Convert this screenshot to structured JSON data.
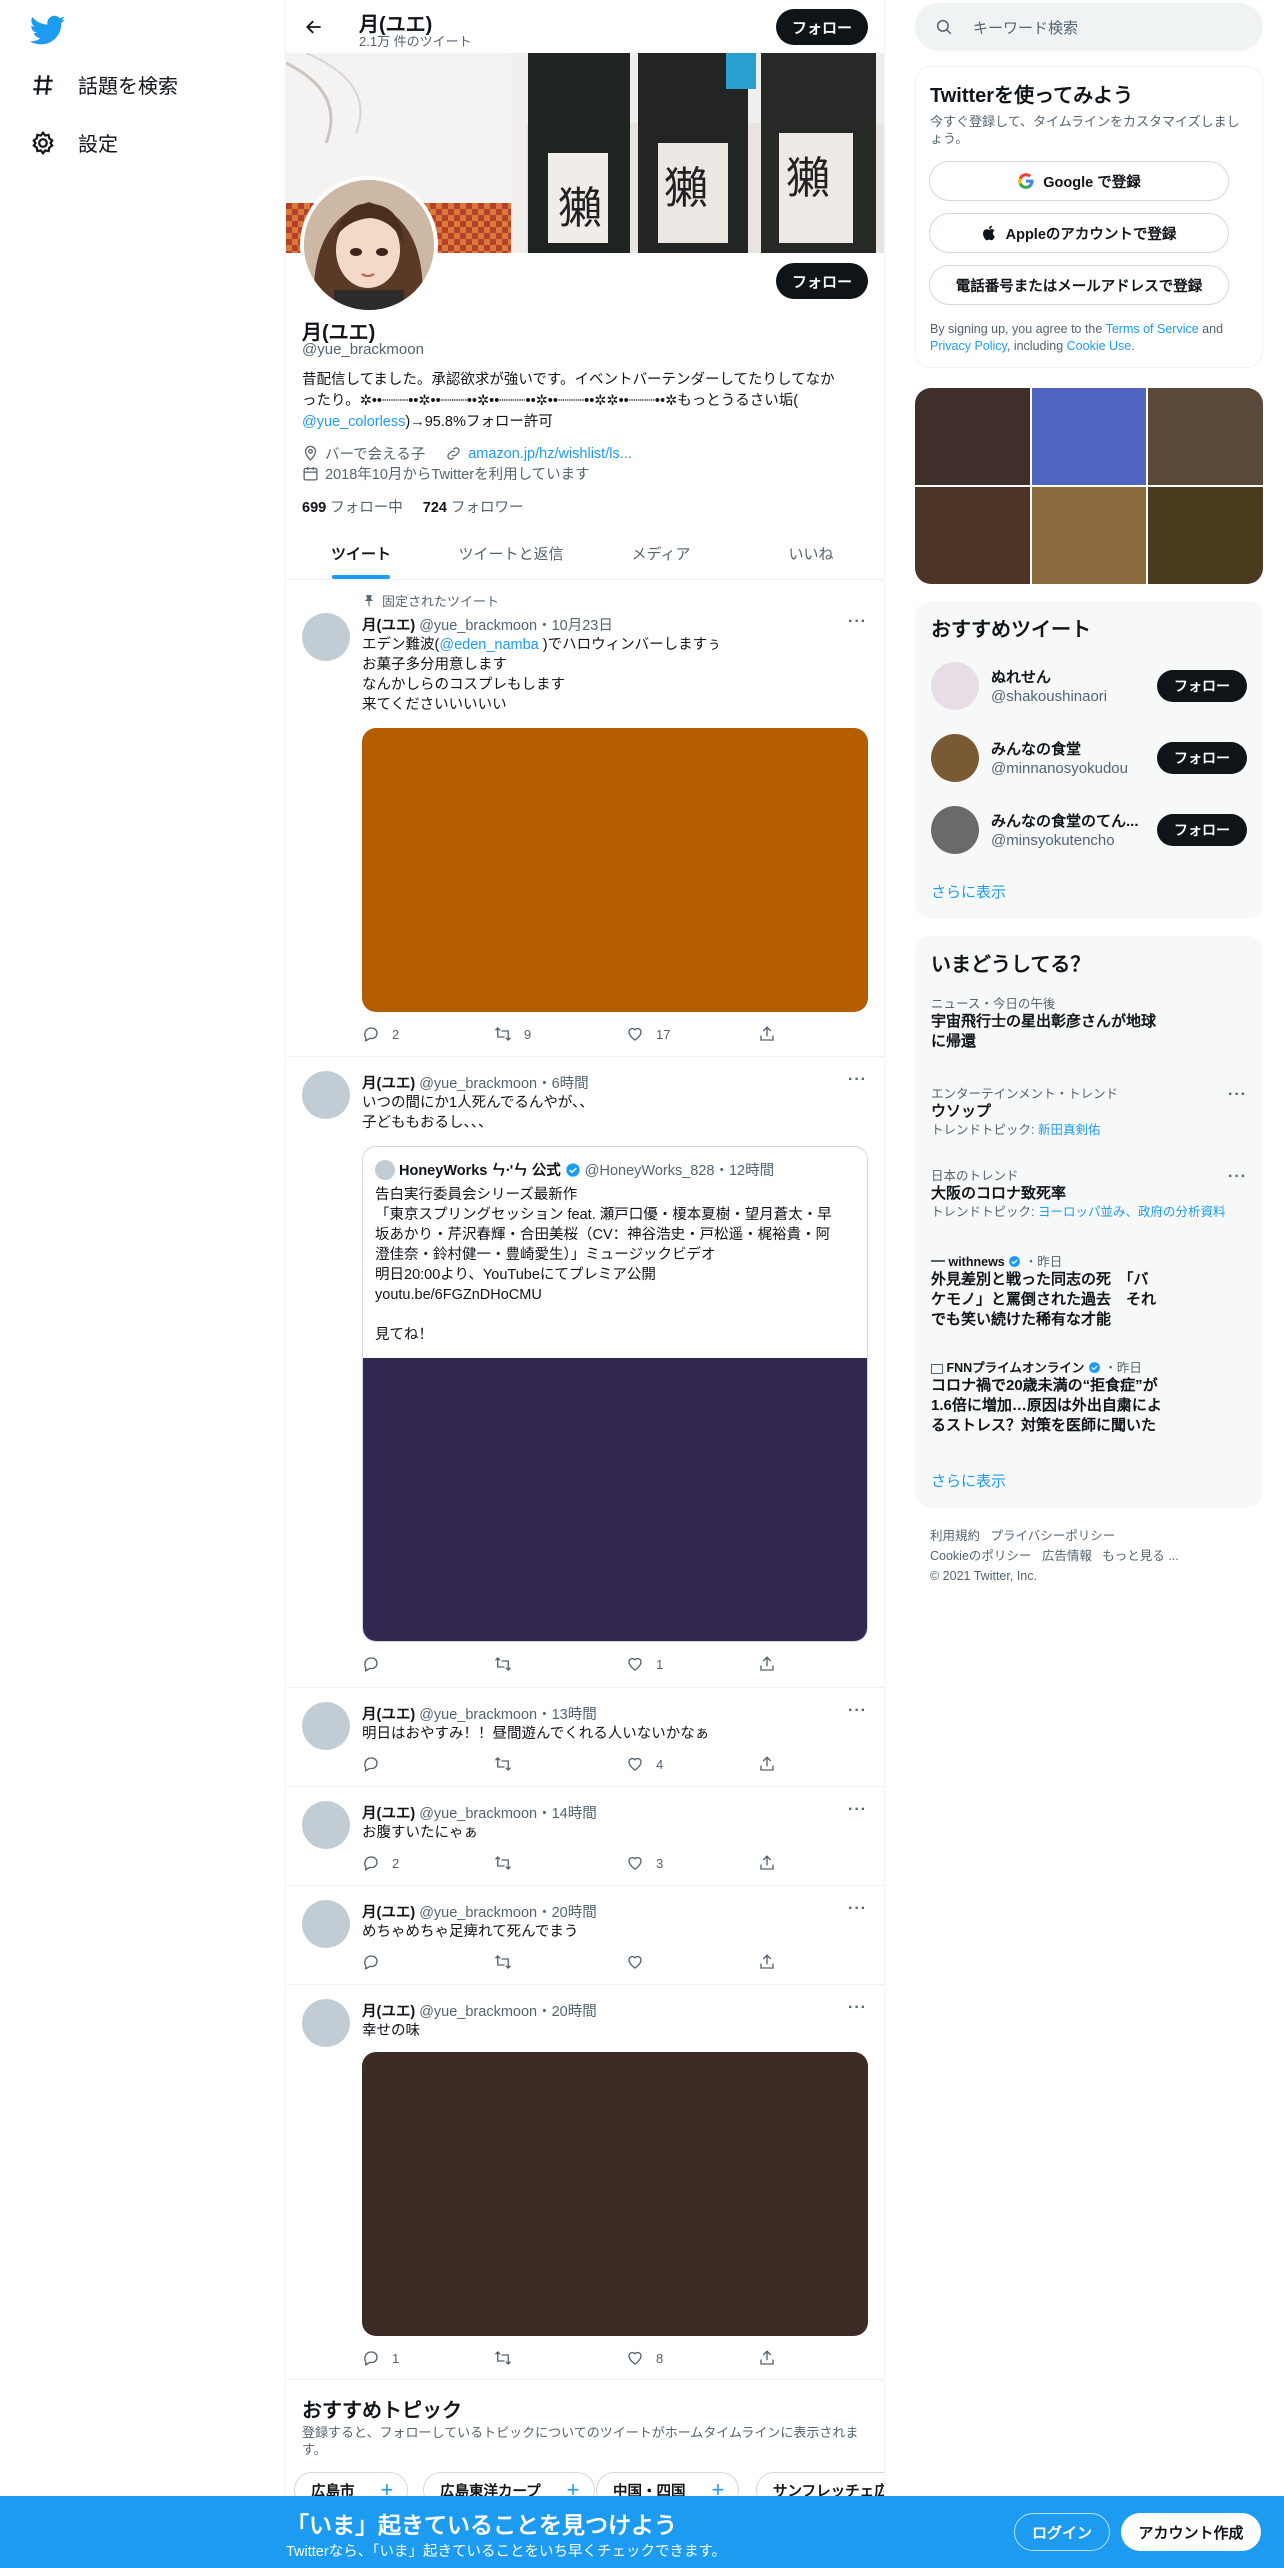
{
  "nav": {
    "explore_label": "話題を検索",
    "settings_label": "設定"
  },
  "header": {
    "name": "月(ユエ)",
    "tweet_count": "2.1万 件のツイート",
    "follow_label": "フォロー"
  },
  "profile": {
    "name": "月(ユエ)",
    "handle": "@yue_brackmoon",
    "follow_label": "フォロー",
    "bio_line1": "昔配信してました。承認欲求が強いです。イベントバーテンダーしてたりしてなか",
    "bio_line2": "ったり。✲••┈┈┈••✲••┈┈┈••✲••┈┈┈••✲••┈┈┈••✲✲••┈┈┈••✲もっとうるさい垢(",
    "bio_mention": "@yue_colorless",
    "bio_line3_suffix": ")→95.8%フォロー許可",
    "location": "バーで会える子",
    "link": "amazon.jp/hz/wishlist/ls...",
    "joined": "2018年10月からTwitterを利用しています",
    "following_count": "699",
    "following_label": "フォロー中",
    "followers_count": "724",
    "followers_label": "フォロワー"
  },
  "tabs": [
    "ツイート",
    "ツイートと返信",
    "メディア",
    "いいね"
  ],
  "pinned_label": "固定されたツイート",
  "tweets": [
    {
      "name": "月(ユエ)",
      "meta": "@yue_brackmoon・10月23日",
      "line1_prefix": "エデン難波(",
      "mention": "@eden_namba",
      "line1_suffix": " )でハロウィンバーしますぅ",
      "line2": "お菓子多分用意します",
      "line3": "なんかしらのコスプレもします",
      "line4": "来てくださいいいいい",
      "media_color": "#b35d00",
      "replies": "2",
      "retweets": "9",
      "likes": "17"
    },
    {
      "name": "月(ユエ)",
      "meta": "@yue_brackmoon・6時間",
      "line1": "いつの間にか1人死んでるんやが、、",
      "line2": "子どももおるし、、、",
      "replies": "",
      "retweets": "",
      "likes": "1"
    },
    {
      "name": "月(ユエ)",
      "meta": "@yue_brackmoon・13時間",
      "line1": "明日はおやすみ！！昼間遊んでくれる人いないかなぁ",
      "replies": "",
      "retweets": "",
      "likes": "4"
    },
    {
      "name": "月(ユエ)",
      "meta": "@yue_brackmoon・14時間",
      "line1": "お腹すいたにゃぁ",
      "replies": "2",
      "retweets": "",
      "likes": "3"
    },
    {
      "name": "月(ユエ)",
      "meta": "@yue_brackmoon・20時間",
      "line1": "めちゃめちゃ足痺れて死んでまう",
      "replies": "",
      "retweets": "",
      "likes": ""
    },
    {
      "name": "月(ユエ)",
      "meta": "@yue_brackmoon・20時間",
      "line1": "幸せの味",
      "media_color": "#3d2b26",
      "replies": "1",
      "retweets": "",
      "likes": "8"
    }
  ],
  "quote": {
    "name": "HoneyWorks ㄣ⸱'ㄣ 公式",
    "meta": "@HoneyWorks_828・12時間",
    "line1": "告白実行委員会シリーズ最新作",
    "line2": "「東京スプリングセッション feat. 瀬戸口優・榎本夏樹・望月蒼太・早",
    "line3": "坂あかり・芹沢春輝・合田美桜（CV：神谷浩史・戸松遥・梶裕貴・阿",
    "line4": "澄佳奈・鈴村健一・豊崎愛生）」ミュージックビデオ",
    "line5": "明日20:00より、YouTubeにてプレミア公開",
    "line6": "youtu.be/6FGZnDHoCMU",
    "line7": "見てね！",
    "media_color": "#332751"
  },
  "topics": {
    "title": "おすすめトピック",
    "desc": "登録すると、フォローしているトピックについてのツイートがホームタイムラインに表示されます。",
    "chips": [
      "広島市",
      "広島東洋カープ",
      "中国・四国",
      "サンフレッチェ広"
    ]
  },
  "search": {
    "placeholder": "キーワード検索"
  },
  "signup": {
    "title": "Twitterを使ってみよう",
    "desc": "今すぐ登録して、タイムラインをカスタマイズしましょう。",
    "google_label": "Google で登録",
    "apple_label": "Appleのアカウントで登録",
    "phone_label": "電話番号またはメールアドレスで登録",
    "legal_prefix": "By signing up, you agree to the ",
    "terms": "Terms of Service",
    "legal_and": " and ",
    "privacy": "Privacy Policy",
    "legal_including": ", including ",
    "cookie": "Cookie Use",
    "legal_end": "."
  },
  "photo_colors": [
    "#3e2f2a",
    "#5064bf",
    "#5a4838",
    "#4e3426",
    "#8d6a3d",
    "#4a3a1e"
  ],
  "recommended": {
    "title": "おすすめツイート",
    "accounts": [
      {
        "name": "ぬれせん",
        "handle": "@shakoushinaori",
        "color": "#e6dde6"
      },
      {
        "name": "みんなの食堂",
        "handle": "@minnanosyokudou",
        "color": "#7a5a34"
      },
      {
        "name": "みんなの食堂のてん...",
        "handle": "@minsyokutencho",
        "color": "#6a6a6a"
      }
    ],
    "follow_label": "フォロー",
    "more_label": "さらに表示"
  },
  "trends": {
    "title": "いまどうしてる？",
    "items": [
      {
        "cat": "ニュース・今日の午後",
        "title1": "宇宙飛行士の星出彰彦さんが地球",
        "title2": "に帰還",
        "sub_prefix": "",
        "sub_link": ""
      },
      {
        "cat": "エンターテインメント・トレンド",
        "title1": "ウソップ",
        "title2": "",
        "sub_prefix": "トレンドトピック: ",
        "sub_link": "新田真剣佑"
      },
      {
        "cat": "日本のトレンド",
        "title1": "大阪のコロナ致死率",
        "title2": "",
        "sub_prefix": "トレンドトピック: ",
        "sub_link": "ヨーロッパ並み、政府の分析資料"
      }
    ],
    "news1_source": "withnews",
    "news1_time": "・昨日",
    "news1_line1": "外見差別と戦った同志の死　「バ",
    "news1_line2": "ケモノ」と罵倒された過去　それ",
    "news1_line3": "でも笑い続けた稀有な才能",
    "news2_source": "FNNプライムオンライン",
    "news2_time": "・昨日",
    "news2_line1": "コロナ禍で20歳未満の“拒食症”が",
    "news2_line2": "1.6倍に増加…原因は外出自粛によ",
    "news2_line3": "るストレス？対策を医師に聞いた",
    "more_label": "さらに表示"
  },
  "footer": {
    "terms": "利用規約",
    "privacy": "プライバシーポリシー",
    "cookie": "Cookieのポリシー",
    "ads": "広告情報",
    "more": "もっと見る ...",
    "copyright": "© 2021 Twitter, Inc."
  },
  "bottom_bar": {
    "title": "「いま」起きていることを見つけよう",
    "subtitle": "Twitterなら、「いま」起きていることをいち早くチェックできます。",
    "login_label": "ログイン",
    "signup_label": "アカウント作成"
  }
}
